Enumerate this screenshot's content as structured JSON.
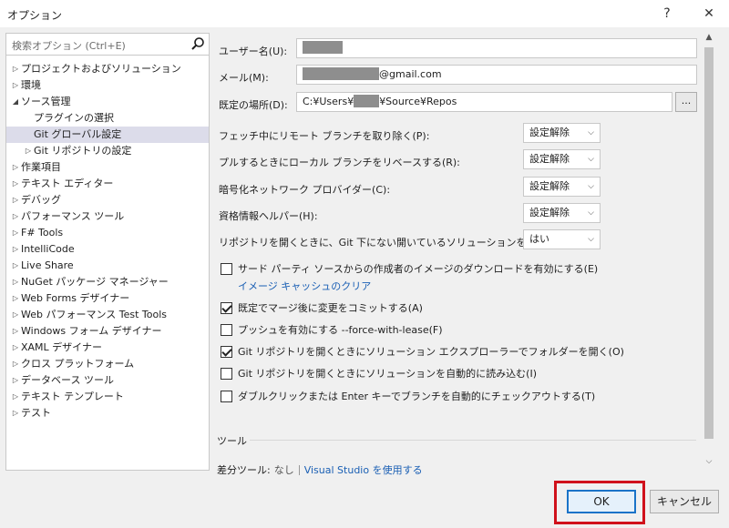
{
  "window": {
    "title": "オプション",
    "help": "?",
    "close": "✕"
  },
  "search": {
    "placeholder": "検索オプション (Ctrl+E)"
  },
  "tree": [
    {
      "label": "プロジェクトおよびソリューション",
      "level": 0,
      "arrow": "▷",
      "selected": false
    },
    {
      "label": "環境",
      "level": 0,
      "arrow": "▷",
      "selected": false
    },
    {
      "label": "ソース管理",
      "level": 0,
      "arrow": "◢",
      "selected": false
    },
    {
      "label": "プラグインの選択",
      "level": 1,
      "arrow": "",
      "selected": false
    },
    {
      "label": "Git グローバル設定",
      "level": 1,
      "arrow": "",
      "selected": true
    },
    {
      "label": "Git リポジトリの設定",
      "level": 1,
      "arrow": "▷",
      "selected": false
    },
    {
      "label": "作業項目",
      "level": 0,
      "arrow": "▷",
      "selected": false
    },
    {
      "label": "テキスト エディター",
      "level": 0,
      "arrow": "▷",
      "selected": false
    },
    {
      "label": "デバッグ",
      "level": 0,
      "arrow": "▷",
      "selected": false
    },
    {
      "label": "パフォーマンス ツール",
      "level": 0,
      "arrow": "▷",
      "selected": false
    },
    {
      "label": "F# Tools",
      "level": 0,
      "arrow": "▷",
      "selected": false
    },
    {
      "label": "IntelliCode",
      "level": 0,
      "arrow": "▷",
      "selected": false
    },
    {
      "label": "Live Share",
      "level": 0,
      "arrow": "▷",
      "selected": false
    },
    {
      "label": "NuGet パッケージ マネージャー",
      "level": 0,
      "arrow": "▷",
      "selected": false
    },
    {
      "label": "Web Forms デザイナー",
      "level": 0,
      "arrow": "▷",
      "selected": false
    },
    {
      "label": "Web パフォーマンス Test Tools",
      "level": 0,
      "arrow": "▷",
      "selected": false
    },
    {
      "label": "Windows フォーム デザイナー",
      "level": 0,
      "arrow": "▷",
      "selected": false
    },
    {
      "label": "XAML デザイナー",
      "level": 0,
      "arrow": "▷",
      "selected": false
    },
    {
      "label": "クロス プラットフォーム",
      "level": 0,
      "arrow": "▷",
      "selected": false
    },
    {
      "label": "データベース ツール",
      "level": 0,
      "arrow": "▷",
      "selected": false
    },
    {
      "label": "テキスト テンプレート",
      "level": 0,
      "arrow": "▷",
      "selected": false
    },
    {
      "label": "テスト",
      "level": 0,
      "arrow": "▷",
      "selected": false
    }
  ],
  "form": {
    "username_label": "ユーザー名(U):",
    "email_label": "メール(M):",
    "email_suffix": "@gmail.com",
    "location_label": "既定の場所(D):",
    "location_prefix": "C:¥Users¥",
    "location_suffix": "¥Source¥Repos",
    "browse_label": "...",
    "prune_label": "フェッチ中にリモート ブランチを取り除く(P):",
    "prune_value": "設定解除",
    "rebase_label": "プルするときにローカル ブランチをリベースする(R):",
    "rebase_value": "設定解除",
    "crypto_label": "暗号化ネットワーク プロバイダー(C):",
    "crypto_value": "設定解除",
    "cred_label": "資格情報ヘルパー(H):",
    "cred_value": "設定解除",
    "close_sln_label": "リポジトリを開くときに、Git 下にない開いているソリューションを閉じる(L):",
    "close_sln_value": "はい"
  },
  "checkboxes": [
    {
      "label": "サード パーティ ソースからの作成者のイメージのダウンロードを有効にする(E)",
      "checked": false
    },
    {
      "label": "既定でマージ後に変更をコミットする(A)",
      "checked": true
    },
    {
      "label": "プッシュを有効にする --force-with-lease(F)",
      "checked": false
    },
    {
      "label": "Git リポジトリを開くときにソリューション エクスプローラーでフォルダーを開く(O)",
      "checked": true
    },
    {
      "label": "Git リポジトリを開くときにソリューションを自動的に読み込む(I)",
      "checked": false
    },
    {
      "label": "ダブルクリックまたは Enter キーでブランチを自動的にチェックアウトする(T)",
      "checked": false
    }
  ],
  "clear_cache_link": "イメージ キャッシュのクリア",
  "tools": {
    "section_title": "ツール",
    "diff_label": "差分ツール:",
    "diff_value": "なし",
    "diff_link": "Visual Studio を使用する"
  },
  "buttons": {
    "ok": "OK",
    "cancel": "キャンセル"
  },
  "colors": {
    "accent": "#1a73c8",
    "link": "#1a5fb4",
    "highlight": "#d0111b",
    "selected_row": "#dcdcea"
  }
}
